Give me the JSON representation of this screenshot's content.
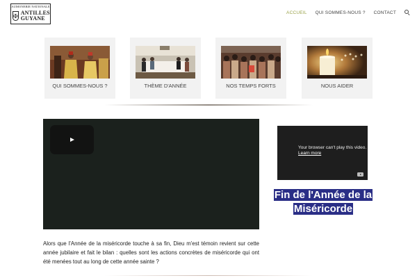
{
  "logo": {
    "top_text": "AUMONERIE NATIONALE",
    "line1": "ANTILLES",
    "line2": "GUYANE",
    "icon": "crest-icon"
  },
  "nav": {
    "items": [
      {
        "label": "ACCUEIL",
        "active": true
      },
      {
        "label": "QUI SOMMES-NOUS ?",
        "active": false
      },
      {
        "label": "CONTACT",
        "active": false
      }
    ],
    "search_icon": "search-icon",
    "active_color": "#9aa24a"
  },
  "cards": [
    {
      "label": "QUI SOMMES-NOUS ?"
    },
    {
      "label": "THÈME D'ANNÉE"
    },
    {
      "label": "NOS TEMPS FORTS"
    },
    {
      "label": "NOUS AIDER"
    }
  ],
  "main_video": {
    "play_icon": "play-icon"
  },
  "description": "Alors que l'Année de la miséricorde touche à sa fin, Dieu m'est témoin revient sur cette année jubilaire et fait le bilan : quelles sont les actions concrètes de miséricorde qui ont été menées tout au long de cette année sainte ?",
  "side_video": {
    "message": "Your browser can't play this video.",
    "link": "Learn more",
    "icon": "youtube-icon"
  },
  "side_title": "Fin de l'Année de la Miséricorde",
  "colors": {
    "title_highlight": "#2a2e86",
    "card_bg": "#f2f2f2",
    "video_bg": "#1b211d"
  }
}
